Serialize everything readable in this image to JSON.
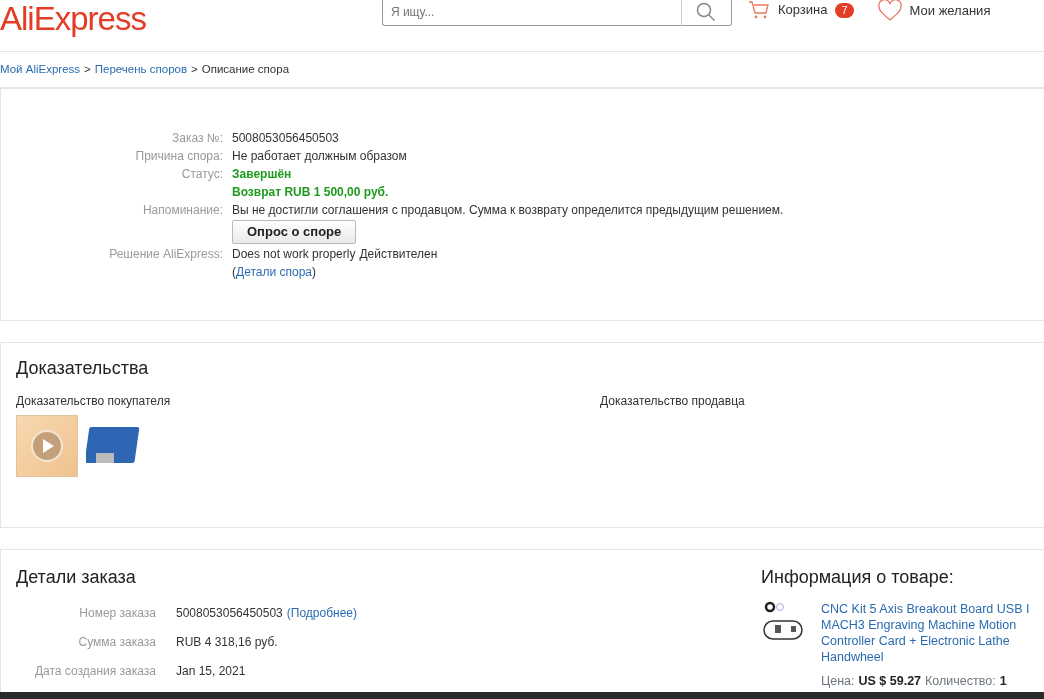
{
  "header": {
    "logo": "AliExpress",
    "search": {
      "placeholder": "Я ищу..."
    },
    "cart": {
      "label": "Корзина",
      "count": "7"
    },
    "wishlist": {
      "label": "Мои желания"
    }
  },
  "breadcrumb": [
    {
      "label": "Мой AliExpress",
      "link": true
    },
    {
      "label": ">",
      "link": false
    },
    {
      "label": "Перечень споров",
      "link": true
    },
    {
      "label": ">",
      "link": false
    },
    {
      "label": "Описание спора",
      "link": false
    }
  ],
  "dispute": {
    "rows": [
      {
        "label": "Заказ №:",
        "kind": "text",
        "lines": [
          "5008053056450503"
        ]
      },
      {
        "label": "Причина спора:",
        "kind": "text",
        "lines": [
          "Не работает должным образом"
        ]
      },
      {
        "label": "Статус:",
        "kind": "status",
        "lines": [
          "Завершён",
          "Возврат RUB 1 500,00 руб."
        ]
      },
      {
        "label": "Напоминание:",
        "kind": "text",
        "lines": [
          "Вы не достигли соглашения с продавцом. Сумма к возврату определится предыдущим решением."
        ]
      },
      {
        "label": "",
        "kind": "button",
        "lines": [
          "Опрос о споре"
        ]
      },
      {
        "label": "Решение AliExpress:",
        "kind": "decision",
        "lines": [
          "Does not work properly",
          "Действителен"
        ],
        "open": "(",
        "link": "Детали спора",
        "close": ")"
      }
    ]
  },
  "evidence": {
    "title": "Доказательства",
    "buyer": {
      "label": "Доказательство покупателя",
      "items": [
        {
          "kind": "video"
        },
        {
          "kind": "photo"
        }
      ]
    },
    "seller": {
      "label": "Доказательство продавца"
    }
  },
  "order": {
    "title": "Детали заказа",
    "rows": [
      {
        "label": "Номер заказа",
        "value": "5008053056450503",
        "link": "(Подробнее)"
      },
      {
        "label": "Сумма заказа",
        "value": "RUB 4 318,16 руб."
      },
      {
        "label": "Дата создания заказа",
        "value": "Jan 15, 2021"
      }
    ]
  },
  "product": {
    "title": "Информация о товаре:",
    "name": "CNC Kit 5 Axis Breakout Board USB I",
    "name_lines": [
      "MACH3 Engraving Machine Motion",
      "Controller Card + Electronic Lathe",
      "Handwheel"
    ],
    "price_label": "Цена:",
    "price": "US $ 59.27",
    "qty_label": "Количество:",
    "qty": "1"
  }
}
